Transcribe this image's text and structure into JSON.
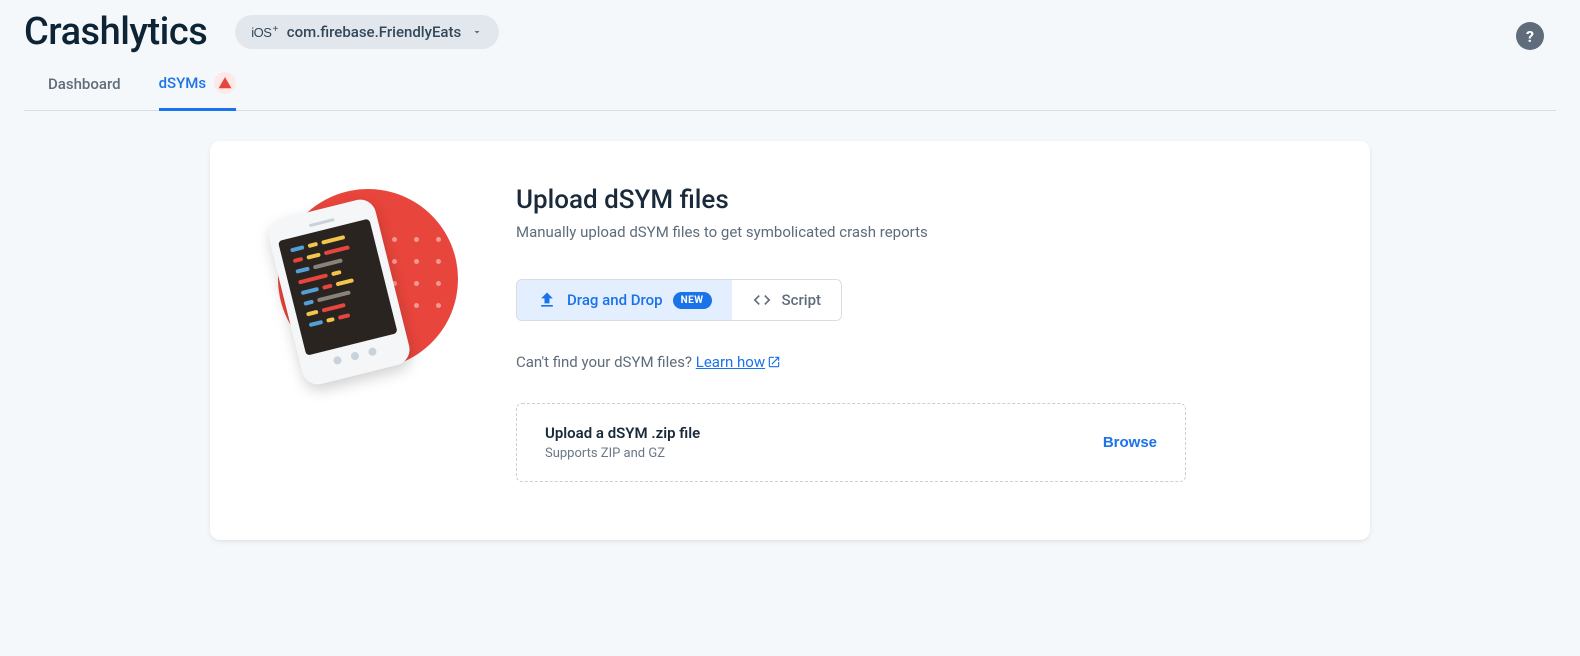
{
  "header": {
    "product": "Crashlytics",
    "app_id": "com.firebase.FriendlyEats",
    "platform_badge": "iOS+",
    "help_label": "?"
  },
  "tabs": [
    {
      "label": "Dashboard",
      "active": false,
      "warn": false
    },
    {
      "label": "dSYMs",
      "active": true,
      "warn": true
    }
  ],
  "main": {
    "title": "Upload dSYM files",
    "subtitle": "Manually upload dSYM files to get symbolicated crash reports",
    "segments": [
      {
        "label": "Drag and Drop",
        "badge": "NEW",
        "icon": "upload",
        "active": true
      },
      {
        "label": "Script",
        "icon": "code",
        "active": false
      }
    ],
    "hint_prefix": "Can't find your dSYM files? ",
    "hint_link": "Learn how",
    "dropzone": {
      "title": "Upload a dSYM .zip file",
      "subtitle": "Supports ZIP and GZ",
      "browse": "Browse"
    }
  }
}
